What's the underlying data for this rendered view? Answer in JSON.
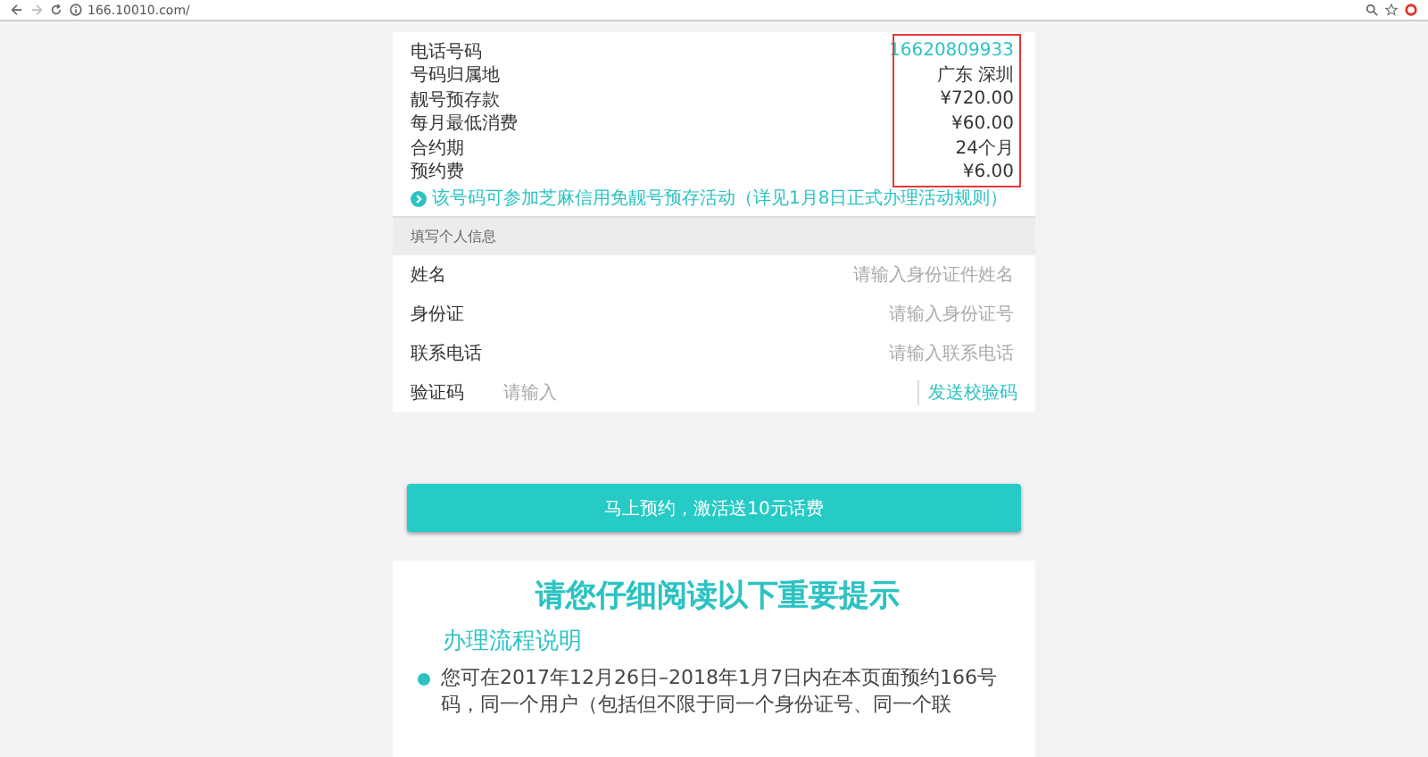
{
  "browser": {
    "url": "166.10010.com/"
  },
  "number_info": [
    {
      "label": "电话号码",
      "value": "16620809933",
      "kind": "number"
    },
    {
      "label": "号码归属地",
      "value": "广东 深圳",
      "kind": "plain"
    },
    {
      "label": "靓号预存款",
      "value": "¥720.00",
      "kind": "plain"
    },
    {
      "label": "每月最低消费",
      "value": "¥60.00",
      "kind": "plain"
    },
    {
      "label": "合约期",
      "value": "24个月",
      "kind": "plain"
    },
    {
      "label": "预约费",
      "value": "¥6.00",
      "kind": "plain"
    }
  ],
  "promo_link": "该号码可参加芝麻信用免靓号预存活动（详见1月8日正式办理活动规则）",
  "form": {
    "title": "填写个人信息",
    "fields": [
      {
        "label": "姓名",
        "placeholder": "请输入身份证件姓名",
        "kind": "text"
      },
      {
        "label": "身份证",
        "placeholder": "请输入身份证号",
        "kind": "text"
      },
      {
        "label": "联系电话",
        "placeholder": "请输入联系电话",
        "kind": "text"
      },
      {
        "label": "验证码",
        "placeholder": "请输入",
        "kind": "code",
        "action": "发送校验码"
      }
    ]
  },
  "submit_button": "马上预约，激活送10元话费",
  "notice": {
    "title": "请您仔细阅读以下重要提示",
    "section": "办理流程说明",
    "items": [
      "您可在2017年12月26日–2018年1月7日内在本页面预约166号码，同一个用户（包括但不限于同一个身份证号、同一个联"
    ]
  }
}
